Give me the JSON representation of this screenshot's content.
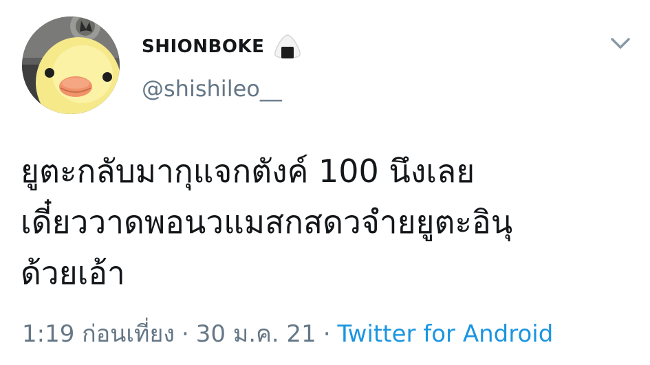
{
  "user": {
    "display_name": "SHIONBOKE",
    "name_emoji": "rice-ball-emoji",
    "handle": "@shishileo__",
    "avatar": "yellow-chick-plush-avatar"
  },
  "tweet": {
    "lines": [
      "ยูตะกลับมากุแจกตังค์ 100 นึงเลย",
      "เดี๋ยววาดพอนวแมสกสดวจำยยูตะอินุ",
      "ด้วยเอ้า"
    ]
  },
  "meta": {
    "time": "1:19 ก่อนเที่ยง",
    "separator": "·",
    "date": "30 ม.ค. 21",
    "source": "Twitter for Android"
  },
  "icons": {
    "more": "chevron-down-icon"
  },
  "colors": {
    "text": "#14171a",
    "secondary": "#657786",
    "link": "#1b95e0"
  }
}
